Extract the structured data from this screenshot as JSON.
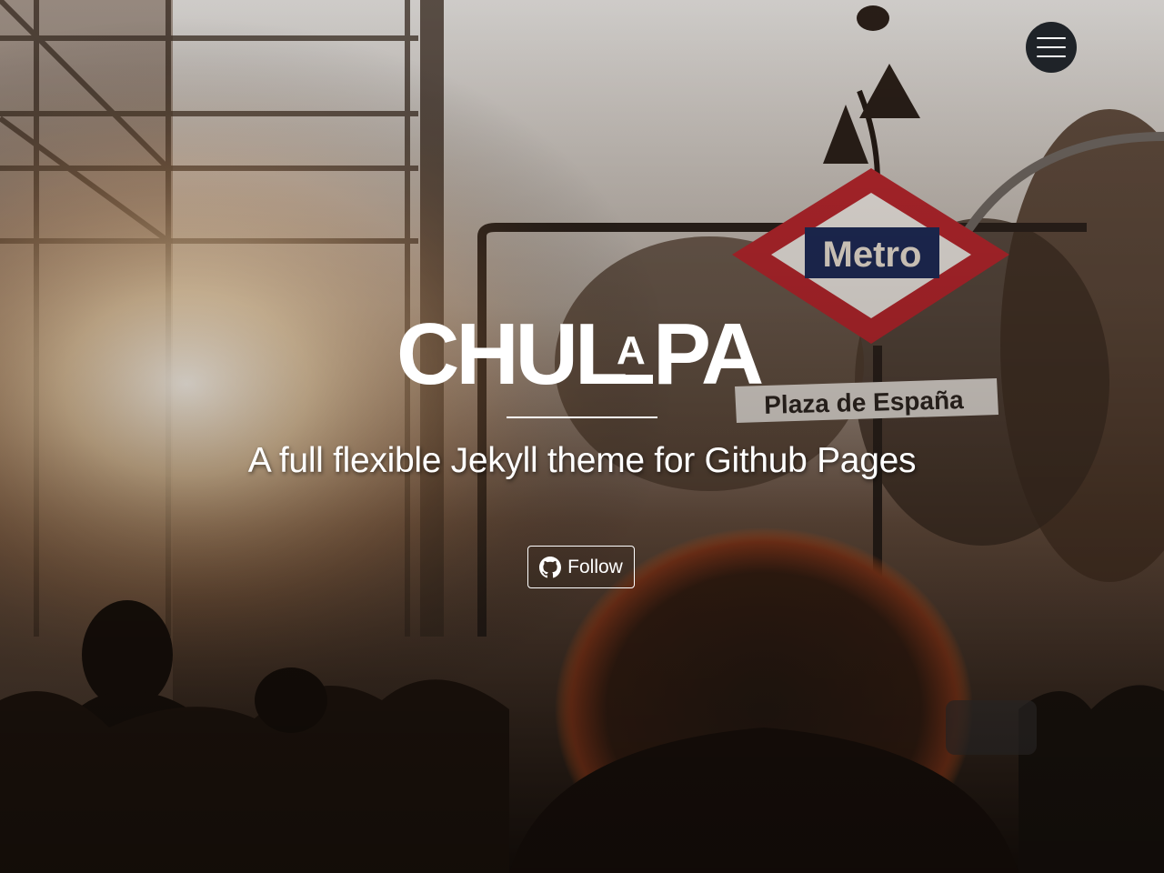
{
  "site": {
    "logo_text": "CHULAPA",
    "tagline": "A full flexible Jekyll theme for Github Pages"
  },
  "hero": {
    "background": {
      "description_icon": "photo",
      "sign_text": "Metro",
      "street_sign_text": "Plaza de España"
    },
    "follow_button": {
      "label": "Follow",
      "icon": "github-icon"
    }
  },
  "navigation": {
    "menu_icon": "hamburger-menu-icon"
  },
  "colors": {
    "menu_button_bg": "#1f2328",
    "text": "#ffffff",
    "metro_red": "#b3262c",
    "metro_blue": "#1e2a55"
  }
}
